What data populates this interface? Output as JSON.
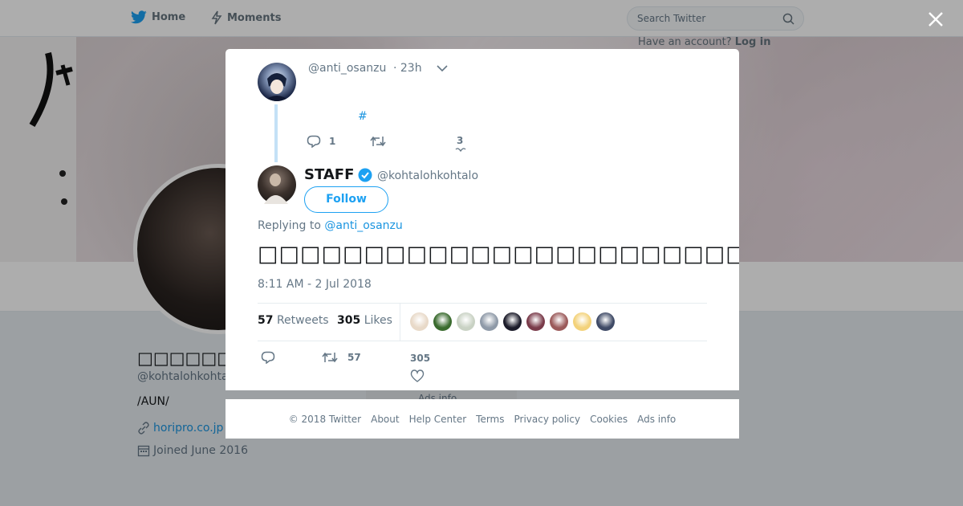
{
  "nav": {
    "home": "Home",
    "moments": "Moments",
    "search_placeholder": "Search Twitter"
  },
  "background_profile": {
    "login_prompt": "Have an account?",
    "login_link": "Log in",
    "name": "□□□□□□STAFF",
    "handle": "@kohtalohkohtalo",
    "bio": "/AUN/",
    "website": "horipro.co.jp",
    "joined": "Joined June 2016",
    "ads_info": "Ads info"
  },
  "modal": {
    "parent_tweet": {
      "handle": "@anti_osanzu",
      "time": "· 23h",
      "hashtag": "#",
      "reply_count": "1",
      "like_count": "3"
    },
    "tweet": {
      "name": "STAFF",
      "handle": "@kohtalohkohtalo",
      "follow_label": "Follow",
      "replying_label": "Replying to",
      "replying_mention": "@anti_osanzu",
      "text": "□□□□□□□□□□□□□□□□□□□□□□□□□□□□□□□□□□□□□□□□□",
      "timestamp": "8:11 AM - 2 Jul 2018",
      "retweets_count": "57",
      "retweets_label": "Retweets",
      "likes_count": "305",
      "likes_label": "Likes",
      "action_retweets": "57",
      "action_likes": "305"
    },
    "liker_colors": [
      "#e8d9c8",
      "#3a6b2e",
      "#c9d2c4",
      "#8f9aa8",
      "#1c1c2a",
      "#7a3b4a",
      "#9b5a5a",
      "#f3d27a",
      "#3f4a66"
    ]
  },
  "footer": {
    "copyright": "© 2018 Twitter",
    "about": "About",
    "help": "Help Center",
    "terms": "Terms",
    "privacy": "Privacy policy",
    "cookies": "Cookies",
    "ads": "Ads info"
  },
  "colors": {
    "accent": "#1da1f2",
    "link": "#1b95e0",
    "muted": "#657786",
    "thread": "#c4e1f6"
  }
}
